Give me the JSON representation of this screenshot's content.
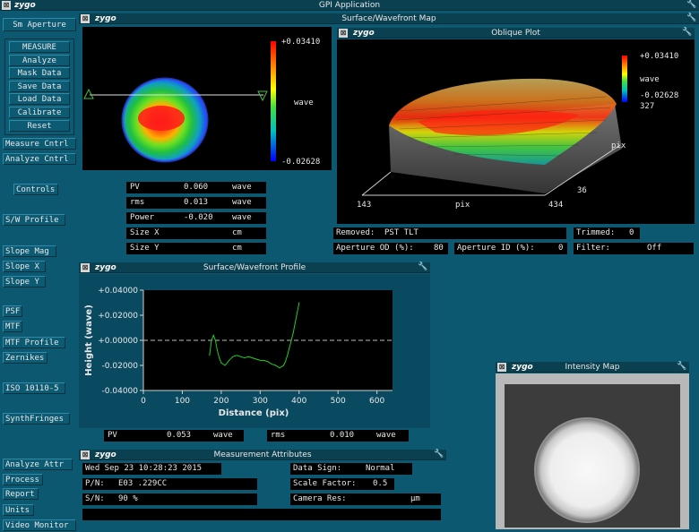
{
  "app": {
    "title": "GPI Application",
    "logo": "zygo"
  },
  "left_panel": {
    "aperture_label": "Sm Aperture",
    "buttons": [
      "MEASURE",
      "Analyze",
      "Mask Data",
      "Save Data",
      "Load Data",
      "Calibrate",
      "Reset"
    ],
    "menu": [
      "Measure Cntrl",
      "Analyze Cntrl",
      "Controls",
      "S/W Profile",
      "Slope Mag",
      "Slope X",
      "Slope Y",
      "PSF",
      "MTF",
      "MTF Profile",
      "Zernikes",
      "ISO 10110-5",
      "SynthFringes",
      "Analyze Attr",
      "Process",
      "Report",
      "Units",
      "Video Monitor"
    ]
  },
  "surface_map": {
    "title": "Surface/Wavefront Map",
    "scale_max": "+0.03410",
    "scale_min": "-0.02628",
    "scale_unit": "wave",
    "results": [
      {
        "label": "PV",
        "value": "0.060",
        "unit": "wave"
      },
      {
        "label": "rms",
        "value": "0.013",
        "unit": "wave"
      },
      {
        "label": "Power",
        "value": "-0.020",
        "unit": "wave"
      },
      {
        "label": "Size X",
        "value": "",
        "unit": "cm"
      },
      {
        "label": "Size Y",
        "value": "",
        "unit": "cm"
      }
    ]
  },
  "oblique_plot": {
    "title": "Oblique Plot",
    "scale_max": "+0.03410",
    "scale_unit": "wave",
    "scale_min": "-0.02628",
    "y_top": "327",
    "y_axis_label": "pix",
    "y_bottom": "36",
    "x_left": "143",
    "x_axis_label": "pix",
    "x_right": "434",
    "removed_label": "Removed:",
    "removed_value": "PST TLT",
    "trimmed_label": "Trimmed:",
    "trimmed_value": "0",
    "ap_od_label": "Aperture OD (%):",
    "ap_od_value": "80",
    "ap_id_label": "Aperture ID (%):",
    "ap_id_value": "0",
    "filter_label": "Filter:",
    "filter_value": "Off"
  },
  "profile": {
    "title": "Surface/Wavefront Profile",
    "pv_label": "PV",
    "pv_value": "0.053",
    "pv_unit": "wave",
    "rms_label": "rms",
    "rms_value": "0.010",
    "rms_unit": "wave"
  },
  "chart_data": {
    "type": "line",
    "xlabel": "Distance (pix)",
    "ylabel": "Height (wave)",
    "xlim": [
      0,
      640
    ],
    "ylim": [
      -0.04,
      0.04
    ],
    "x_ticks": [
      0,
      100,
      200,
      300,
      400,
      500,
      600
    ],
    "y_ticks": [
      "+0.04000",
      "+0.02000",
      "+0.00000",
      "-0.02000",
      "-0.04000"
    ],
    "reference_line": 0,
    "series": [
      {
        "color": "#22cc22",
        "x": [
          170,
          175,
          180,
          185,
          190,
          195,
          200,
          210,
          220,
          230,
          240,
          250,
          260,
          270,
          280,
          290,
          300,
          310,
          320,
          330,
          340,
          350,
          360,
          365,
          370,
          375,
          380,
          385,
          390,
          395,
          400
        ],
        "y": [
          -0.012,
          0.0,
          0.004,
          0.0,
          -0.008,
          -0.014,
          -0.018,
          -0.02,
          -0.016,
          -0.013,
          -0.012,
          -0.013,
          -0.014,
          -0.013,
          -0.014,
          -0.015,
          -0.016,
          -0.016,
          -0.017,
          -0.019,
          -0.02,
          -0.022,
          -0.02,
          -0.017,
          -0.012,
          -0.006,
          0.0,
          0.006,
          0.014,
          0.022,
          0.03
        ]
      }
    ]
  },
  "measurement_attributes": {
    "title": "Measurement Attributes",
    "date": "Wed Sep 23 10:28:23 2015",
    "pn_label": "P/N:",
    "pn_value": "E03 .229CC",
    "sn_label": "S/N:",
    "sn_value": "90 %",
    "data_sign_label": "Data Sign:",
    "data_sign_value": "Normal",
    "scale_factor_label": "Scale Factor:",
    "scale_factor_value": "0.5",
    "camera_res_label": "Camera Res:",
    "camera_res_unit": "µm"
  },
  "intensity_map": {
    "title": "Intensity Map"
  },
  "icons": {
    "close": "close-icon",
    "wrench": "wrench-icon",
    "marker": "triangle-marker-icon"
  },
  "colors": {
    "background": "#0c5870",
    "titlebar": "#0a4050",
    "field": "#000000",
    "text": "#e8e8e8",
    "profile_line": "#22cc22"
  }
}
